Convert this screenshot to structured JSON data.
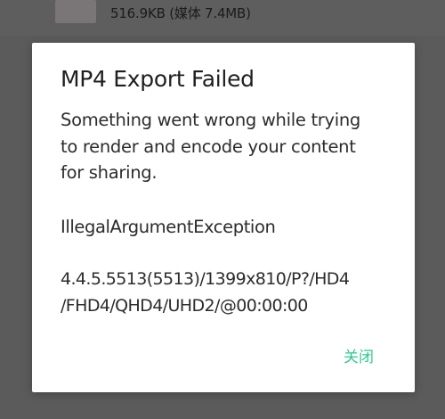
{
  "background": {
    "file_size_text": "516.9KB (媒体 7.4MB)"
  },
  "dialog": {
    "title": "MP4 Export Failed",
    "message": "Something went wrong while trying\nto render and encode your content\nfor sharing.",
    "exception": "IllegalArgumentException",
    "details": "4.4.5.5513(5513)/1399x810/P?/HD4\n/FHD4/QHD4/UHD2/@00:00:00",
    "close_label": "关闭"
  },
  "colors": {
    "scrim": "#5b5b5b",
    "dialog_background": "#ffffff",
    "accent": "#2ecb8e",
    "text": "#2c2c2c"
  }
}
